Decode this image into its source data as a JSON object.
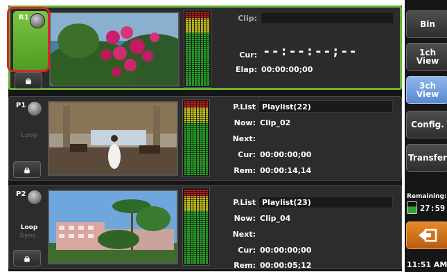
{
  "channels": {
    "r1": {
      "id": "R1",
      "clip_label": "Clip:",
      "clip_value": "",
      "big_tc": "--:--:--;--",
      "cur_label": "Cur:",
      "elap_label": "Elap:",
      "elap_value": "00:00:00;00"
    },
    "p1": {
      "id": "P1",
      "loop_label": "Loop",
      "plist_label": "P.List",
      "plist_value": "Playlist(22)",
      "now_label": "Now:",
      "now_value": "Clip_02",
      "next_label": "Next:",
      "next_value": "",
      "cur_label": "Cur:",
      "cur_value": "00:00:00;00",
      "rem_label": "Rem:",
      "rem_value": "00:00:14,14"
    },
    "p2": {
      "id": "P2",
      "loop_label": "Loop",
      "sync_label": "Sync.",
      "plist_label": "P.List",
      "plist_value": "Playlist(23)",
      "now_label": "Now:",
      "now_value": "Clip_04",
      "next_label": "Next:",
      "next_value": "",
      "cur_label": "Cur:",
      "cur_value": "00:00:00;00",
      "rem_label": "Rem:",
      "rem_value": "00:00:05;12"
    }
  },
  "sidebar": {
    "bin": "Bin",
    "view1_line1": "1ch",
    "view1_line2": "View",
    "view3_line1": "3ch",
    "view3_line2": "View",
    "config": "Config.",
    "transfer": "Transfer",
    "remaining_label": "Remaining:",
    "remaining_value": "27:59",
    "time": "11:51 AM"
  },
  "colors": {
    "record_green": "#66b32e",
    "highlight_red": "#d7262c",
    "active_blue": "#7aa5e0",
    "orange": "#d67a1e"
  },
  "icons": [
    "lock-icon",
    "tally-lamp-icon",
    "back-arrow-icon",
    "battery-icon"
  ]
}
